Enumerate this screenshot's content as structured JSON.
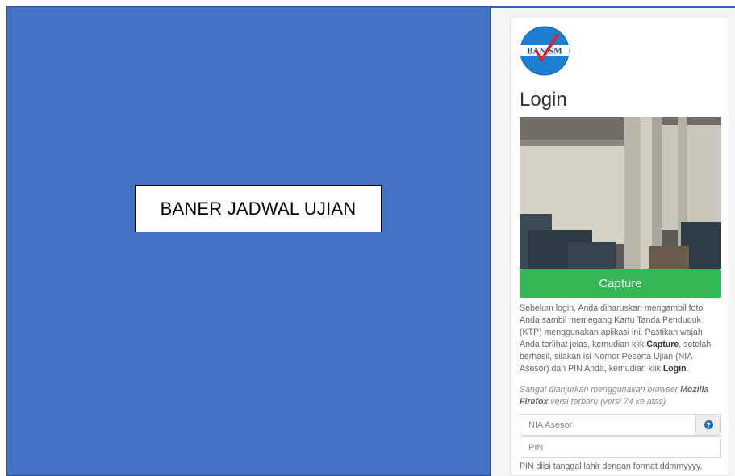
{
  "banner": {
    "label": "BANER JADWAL UJIAN",
    "background_color": "#4472c4"
  },
  "logo": {
    "text": "BAN-SM",
    "icon": "checkmark-logo-icon"
  },
  "login": {
    "title": "Login",
    "capture_label": "Capture",
    "capture_color": "#33b853",
    "info_part1": "Sebelum login, Anda diharuskan mengambil foto Anda sambil memegang Kartu Tanda Penduduk (KTP) menggunakan aplikasi ini. Pastikan wajah Anda terlihat jelas, kemudian klik ",
    "info_capture_word": "Capture",
    "info_part2": ", setelah berhasil, silakan isi Nomor Peserta Ujian (NIA Asesor) dan PIN Anda, kemudian klik ",
    "info_login_word": "Login",
    "info_part3": ".",
    "note_part1": "Sangat dianjurkan menggunakan browser ",
    "note_browser": "Mozilla Firefox",
    "note_part2": " versi terbaru (versi 74 ke atas)",
    "nia_placeholder": "NIA Asesor",
    "pin_placeholder": "PIN",
    "help_icon": "question-circle-icon",
    "pin_help": "PIN diisi tanggal lahir dengan format ddmmyyyy,"
  }
}
